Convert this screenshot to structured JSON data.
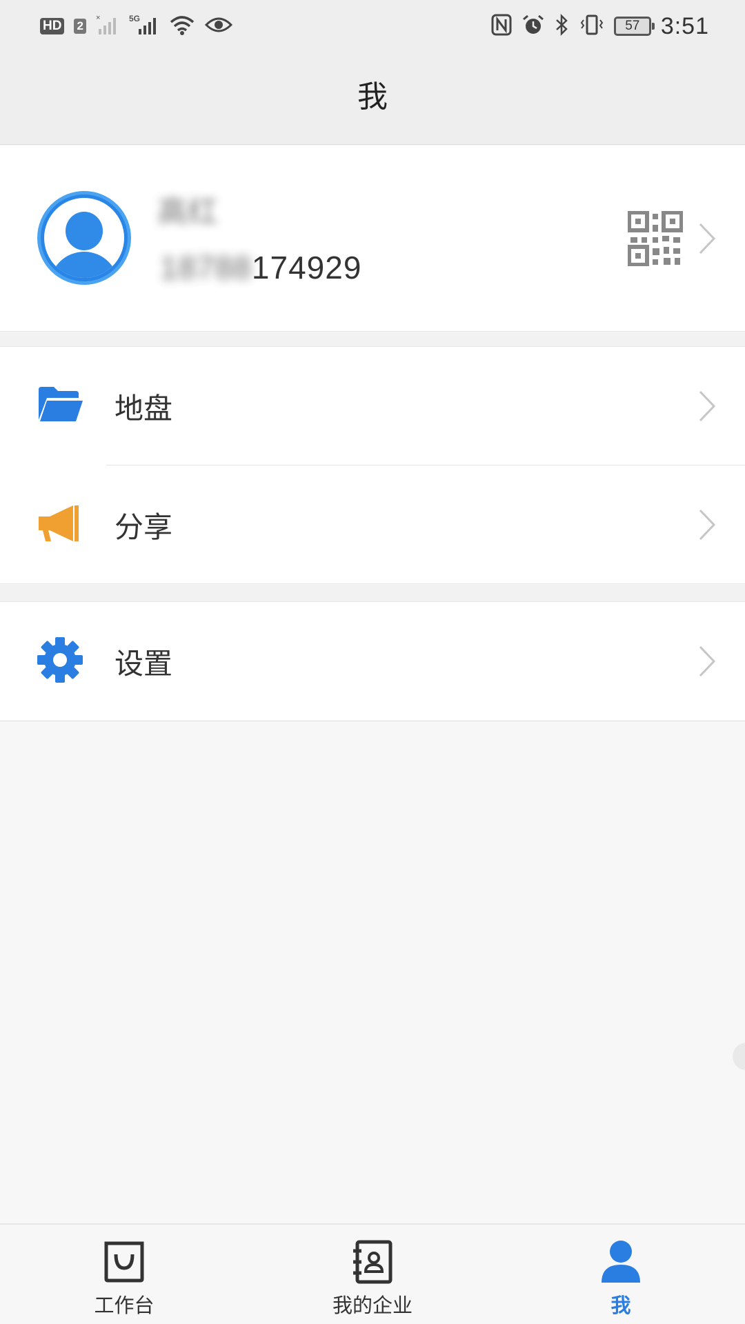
{
  "status_bar": {
    "left_badges": [
      "HD",
      "2",
      "5G"
    ],
    "battery_level": "57",
    "time": "3:51",
    "icons": [
      "signal-icon",
      "wifi-icon",
      "eye-icon",
      "nfc-icon",
      "alarm-icon",
      "bluetooth-icon",
      "vibrate-icon",
      "battery-icon"
    ]
  },
  "header": {
    "title": "我"
  },
  "profile": {
    "name": "高红",
    "phone_hidden_prefix": "18788",
    "phone_visible": "174929",
    "qr_icon": "qr-code-icon",
    "arrow_icon": "chevron-right-icon"
  },
  "menu": {
    "group1": [
      {
        "label": "地盘",
        "icon": "folder-icon",
        "color": "#2a7de1"
      },
      {
        "label": "分享",
        "icon": "megaphone-icon",
        "color": "#f0a030"
      }
    ],
    "group2": [
      {
        "label": "设置",
        "icon": "gear-icon",
        "color": "#2a7de1"
      }
    ]
  },
  "tabs": [
    {
      "label": "工作台",
      "icon": "workbench-bag-icon",
      "active": false
    },
    {
      "label": "我的企业",
      "icon": "contacts-book-icon",
      "active": false
    },
    {
      "label": "我",
      "icon": "person-icon",
      "active": true
    }
  ],
  "colors": {
    "accent": "#2a7de1",
    "header_bg": "#eeeeee",
    "page_bg": "#f7f7f7",
    "share_orange": "#f0a030"
  }
}
